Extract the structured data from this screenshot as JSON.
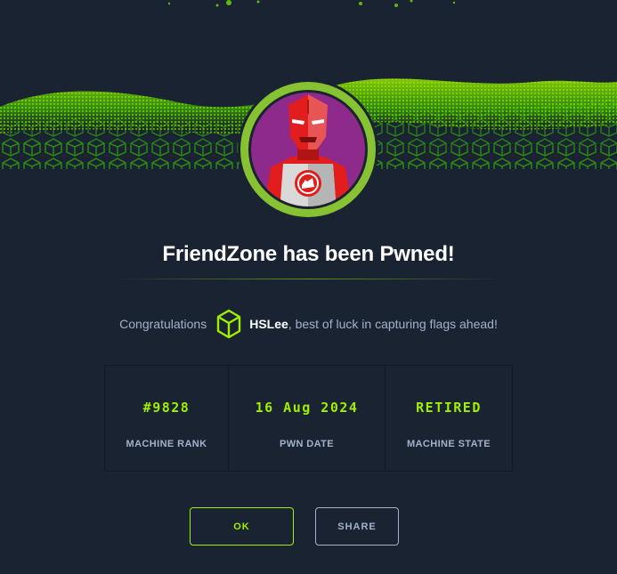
{
  "machine": {
    "name": "FriendZone",
    "pwned_title": "FriendZone has been Pwned!"
  },
  "congrats": {
    "prefix": "Congratulations",
    "username": "HSLee",
    "suffix": ", best of luck in capturing flags ahead!"
  },
  "stats": [
    {
      "value": "#9828",
      "label": "MACHINE RANK"
    },
    {
      "value": "16 Aug 2024",
      "label": "PWN DATE"
    },
    {
      "value": "RETIRED",
      "label": "MACHINE STATE"
    }
  ],
  "buttons": {
    "ok": "OK",
    "share": "SHARE"
  },
  "colors": {
    "background": "#1a2332",
    "accent": "#9fef00",
    "muted_text": "#a4b1cd",
    "avatar_bg": "#8e2a8c"
  },
  "icons": {
    "banner": "green-circuit-wave",
    "avatar": "red-hero-avatar",
    "user": "hackthebox-cube-icon"
  }
}
